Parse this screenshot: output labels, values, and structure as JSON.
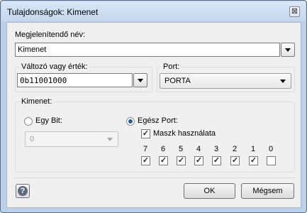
{
  "window": {
    "title": "Tulajdonságok: Kimenet",
    "close_glyph": "⊠"
  },
  "display_name": {
    "label": "Megjelenítendő név:",
    "value": "Kimenet"
  },
  "variable": {
    "label": "Változó vagy érték:",
    "value": "0b11001000"
  },
  "port": {
    "label": "Port:",
    "selected": "PORTA"
  },
  "output_group": {
    "title": "Kimenet:",
    "single_bit": {
      "label": "Egy Bit:",
      "checked": false,
      "value": "0"
    },
    "whole_port": {
      "label": "Egész Port:",
      "checked": true
    },
    "mask": {
      "label": "Maszk használata",
      "checked": true
    },
    "bits": [
      {
        "label": "7",
        "checked": true
      },
      {
        "label": "6",
        "checked": true
      },
      {
        "label": "5",
        "checked": true
      },
      {
        "label": "4",
        "checked": true
      },
      {
        "label": "3",
        "checked": true
      },
      {
        "label": "2",
        "checked": true
      },
      {
        "label": "1",
        "checked": true
      },
      {
        "label": "0",
        "checked": false
      }
    ]
  },
  "buttons": {
    "help": "?",
    "ok": "OK",
    "cancel": "Mégsem"
  },
  "colors": {
    "titlebar": "#c4d7ee",
    "client": "#f0f0f0",
    "accent": "#2a5ea0"
  }
}
